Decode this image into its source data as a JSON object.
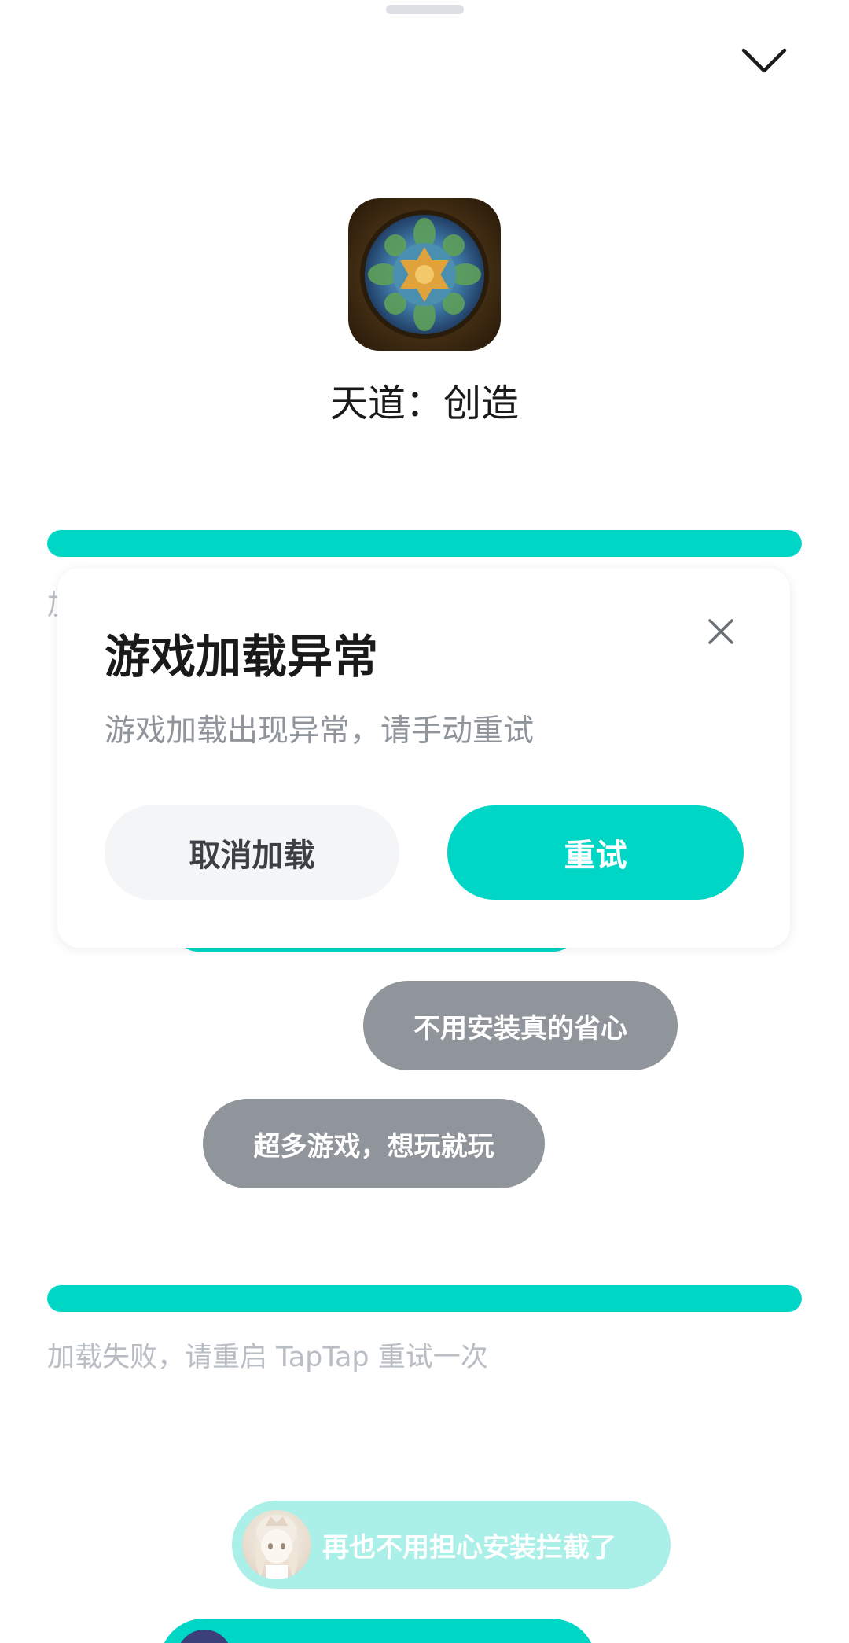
{
  "game": {
    "title": "天道：创造",
    "icon": "game-app-icon"
  },
  "loading": {
    "progress_top": 1.0,
    "progress_bottom": 1.0,
    "peek_char": "加",
    "fail_message": "加载失败，请重启 TapTap 重试一次"
  },
  "bubbles": [
    "不用安装真的省心",
    "超多游戏，想玩就玩"
  ],
  "promo": {
    "message": "再也不用担心安装拦截了"
  },
  "dialog": {
    "title": "游戏加载异常",
    "message": "游戏加载出现异常，请手动重试",
    "cancel_label": "取消加载",
    "retry_label": "重试"
  },
  "colors": {
    "accent": "#00d6c6",
    "bubble_gray": "#8f959b",
    "light_accent": "#aaf0e8"
  }
}
